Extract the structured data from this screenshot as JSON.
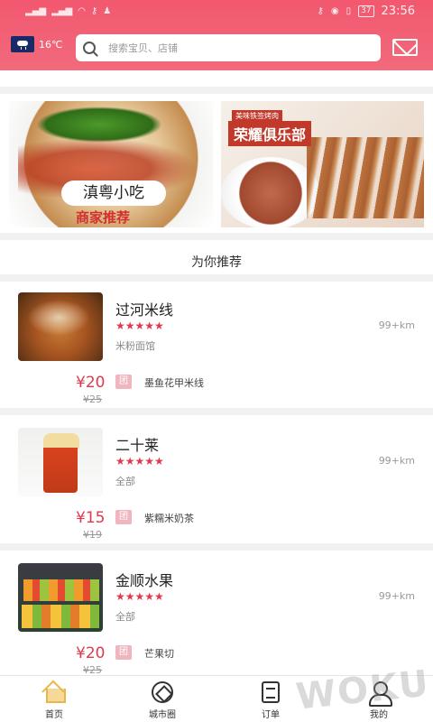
{
  "statusbar": {
    "time": "23:56",
    "battery": "37"
  },
  "header": {
    "weather_temp": "16℃",
    "search_placeholder": "搜索宝贝、店铺"
  },
  "banners": {
    "left": {
      "tag": "滇粤小吃",
      "subtitle": "商家推荐"
    },
    "right": {
      "small_text": "美味铁签烤肉",
      "title": "荣耀俱乐部"
    }
  },
  "section_title": "为你推荐",
  "shops": [
    {
      "name": "过河米线",
      "distance": "99+km",
      "category": "米粉面馆",
      "price": "¥20",
      "old_price": "¥25",
      "tuan": "团",
      "deal": "墨鱼花甲米线"
    },
    {
      "name": "二十莱",
      "distance": "99+km",
      "category": "全部",
      "price": "¥15",
      "old_price": "¥19",
      "tuan": "团",
      "deal": "紫糯米奶茶"
    },
    {
      "name": "金顺水果",
      "distance": "99+km",
      "category": "全部",
      "price": "¥20",
      "old_price": "¥25",
      "tuan": "团",
      "deal": "芒果切"
    }
  ],
  "stars": "★★★★★",
  "tabbar": {
    "home": "首页",
    "city": "城市圈",
    "order": "订单",
    "me": "我的"
  },
  "watermark": "WOKU"
}
